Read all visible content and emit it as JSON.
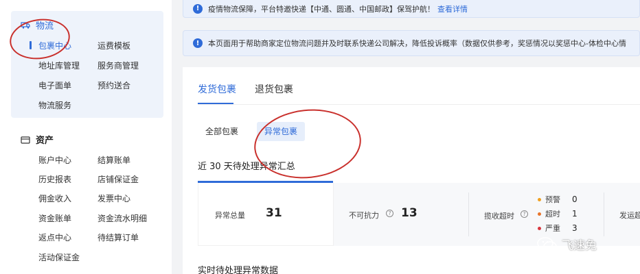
{
  "sidebar": {
    "logistics": {
      "title": "物流",
      "items": [
        "包裹中心",
        "运费模板",
        "地址库管理",
        "服务商管理",
        "电子面单",
        "预约送合",
        "物流服务"
      ],
      "current": "包裹中心"
    },
    "assets": {
      "title": "资产",
      "items": [
        "账户中心",
        "结算账单",
        "历史报表",
        "店铺保证金",
        "佣金收入",
        "发票中心",
        "资金账单",
        "资金流水明细",
        "返点中心",
        "待结算订单",
        "活动保证金"
      ]
    }
  },
  "notices": {
    "top": {
      "text": "疫情物流保障，平台特邀快递【中通、圆通、中国邮政】保驾护航！",
      "link": "查看详情"
    },
    "second": {
      "text": "本页面用于帮助商家定位物流问题并及时联系快递公司解决，降低投诉概率（数据仅供参考，奖惩情况以奖惩中心-体检中心情"
    }
  },
  "main": {
    "tabs": [
      {
        "label": "发货包裹",
        "active": true
      },
      {
        "label": "退货包裹",
        "active": false
      }
    ],
    "segments": [
      {
        "label": "全部包裹",
        "active": false
      },
      {
        "label": "异常包裹",
        "active": true
      }
    ],
    "summary_title": "近 30 天待处理异常汇总",
    "stats": {
      "total": {
        "label": "异常总量",
        "value": "31"
      },
      "force_majeure": {
        "label": "不可抗力",
        "value": "13"
      },
      "pickup_timeout": {
        "label": "揽收超时",
        "levels": [
          {
            "label": "预警",
            "value": "0",
            "color": "#f0a020"
          },
          {
            "label": "超时",
            "value": "1",
            "color": "#e8742a"
          },
          {
            "label": "严重",
            "value": "3",
            "color": "#d9363e"
          }
        ]
      },
      "next_label": "发运超"
    },
    "realtime_title": "实时待处理异常数据"
  },
  "watermark": {
    "text": "飞速免"
  },
  "colors": {
    "accent": "#2f6bd8",
    "annotation": "#c9302c"
  }
}
